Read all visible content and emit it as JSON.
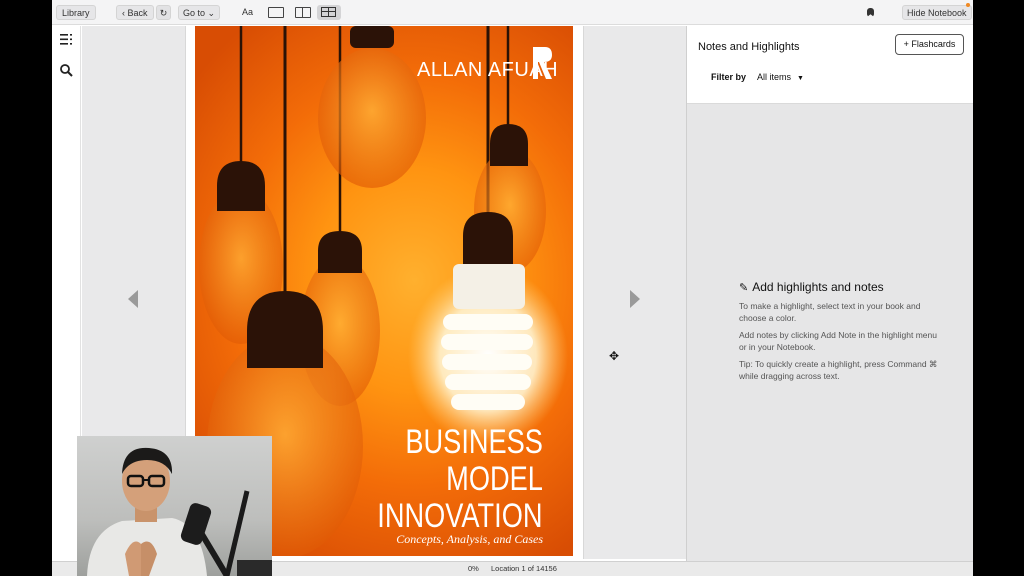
{
  "toolbar": {
    "library_label": "Library",
    "back_label": "Back",
    "goto_label": "Go to",
    "font_label": "Aa",
    "hide_notebook_label": "Hide Notebook"
  },
  "sidebar": {
    "items": [
      {
        "icon": "table-of-contents-icon"
      },
      {
        "icon": "search-icon"
      }
    ]
  },
  "book": {
    "author": "ALLAN AFUAH",
    "publisher_logo": "ROUTLEDGE",
    "title_lines": [
      "BUSINESS",
      "MODEL",
      "INNOVATION"
    ],
    "subtitle": "Concepts, Analysis, and Cases"
  },
  "notebook": {
    "title": "Notes and Highlights",
    "flashcards_label": "+ Flashcards",
    "filter_label": "Filter by",
    "filter_value": "All items",
    "empty_title": "Add highlights and notes",
    "empty_paragraphs": [
      "To make a highlight, select text in your book and choose a color.",
      "Add notes by clicking Add Note in the highlight menu or in your Notebook.",
      "Tip: To quickly create a highlight, press Command ⌘ while dragging across text."
    ]
  },
  "status": {
    "progress": "0%",
    "location": "Location 1 of 14156"
  },
  "colors": {
    "cover_orange": "#f36c08",
    "cover_glow": "#ffb02e",
    "accent_dot": "#f08a24"
  }
}
